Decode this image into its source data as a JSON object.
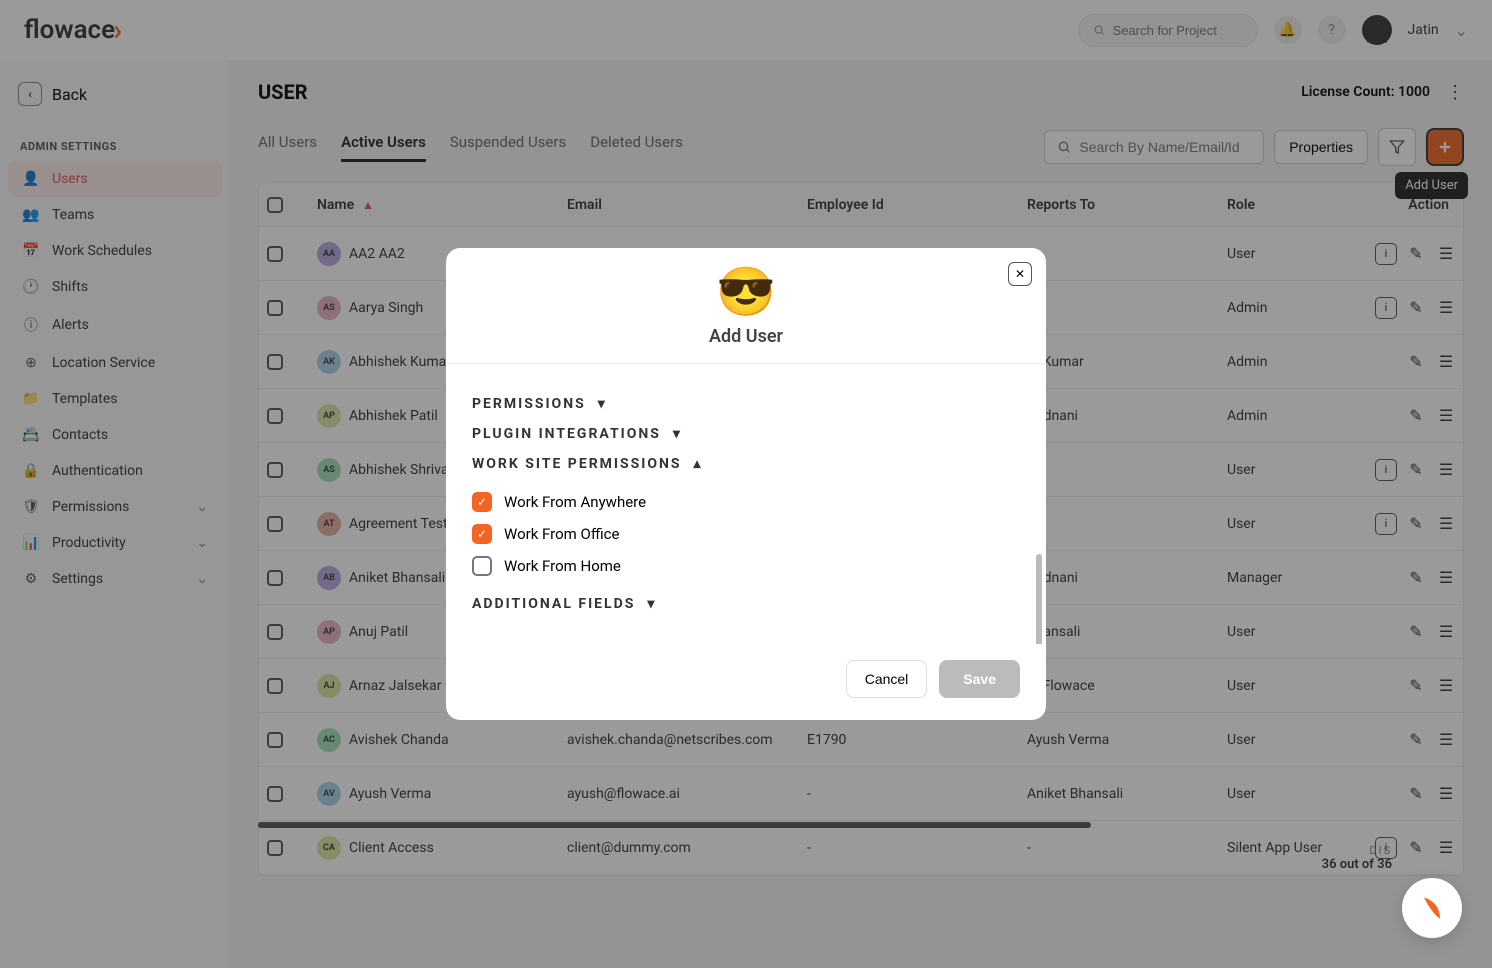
{
  "header": {
    "logo": "flowace",
    "search_placeholder": "Search for Project",
    "user_name": "Jatin"
  },
  "sidebar": {
    "back_label": "Back",
    "heading": "ADMIN SETTINGS",
    "items": [
      {
        "label": "Users",
        "icon": "user",
        "active": true
      },
      {
        "label": "Teams",
        "icon": "team"
      },
      {
        "label": "Work Schedules",
        "icon": "calendar"
      },
      {
        "label": "Shifts",
        "icon": "clock"
      },
      {
        "label": "Alerts",
        "icon": "alert"
      },
      {
        "label": "Location Service",
        "icon": "location"
      },
      {
        "label": "Templates",
        "icon": "folder"
      },
      {
        "label": "Contacts",
        "icon": "contact"
      },
      {
        "label": "Authentication",
        "icon": "lock"
      },
      {
        "label": "Permissions",
        "icon": "shield",
        "has_children": true
      },
      {
        "label": "Productivity",
        "icon": "chart",
        "has_children": true
      },
      {
        "label": "Settings",
        "icon": "gear",
        "has_children": true
      }
    ]
  },
  "page": {
    "title": "USER",
    "license_label": "License Count: 1000",
    "tabs": [
      "All Users",
      "Active Users",
      "Suspended Users",
      "Deleted Users"
    ],
    "active_tab": 1,
    "search_placeholder": "Search By Name/Email/Id",
    "properties_btn": "Properties",
    "add_tooltip": "Add User"
  },
  "table": {
    "columns": [
      "",
      "Name",
      "Email",
      "Employee Id",
      "Reports To",
      "Role",
      "Action"
    ],
    "rows": [
      {
        "initials": "AA",
        "name": "AA2 AA2",
        "email": "",
        "emp": "",
        "reports": "",
        "role": "User",
        "color": "#b6a7e3",
        "has_info": true
      },
      {
        "initials": "AS",
        "name": "Aarya Singh",
        "email": "",
        "emp": "",
        "reports": "",
        "role": "Admin",
        "color": "#e9b3c1",
        "has_info": true
      },
      {
        "initials": "AK",
        "name": "Abhishek Kumar",
        "email": "",
        "emp": "",
        "reports": "nt Kumar",
        "role": "Admin",
        "color": "#a8d3e8"
      },
      {
        "initials": "AP",
        "name": "Abhishek Patil",
        "email": "",
        "emp": "",
        "reports": "Kodnani",
        "role": "Admin",
        "color": "#d8e8a1"
      },
      {
        "initials": "AS",
        "name": "Abhishek Shrivastava",
        "email": "",
        "emp": "",
        "reports": "",
        "role": "User",
        "color": "#a3e0b8",
        "has_info": true
      },
      {
        "initials": "AT",
        "name": "Agreement Testing",
        "email": "",
        "emp": "",
        "reports": "",
        "role": "User",
        "color": "#e8b0a3",
        "has_info": true
      },
      {
        "initials": "AB",
        "name": "Aniket Bhansali",
        "email": "",
        "emp": "",
        "reports": "Kodnani",
        "role": "Manager",
        "color": "#b6a7e3"
      },
      {
        "initials": "AP",
        "name": "Anuj Patil",
        "email": "",
        "emp": "",
        "reports": "Bhansali",
        "role": "User",
        "color": "#e9b3c1"
      },
      {
        "initials": "AJ",
        "name": "Arnaz Jalsekar",
        "email": "",
        "emp": "",
        "reports": "ta Flowace",
        "role": "User",
        "color": "#d8e8a1"
      },
      {
        "initials": "AC",
        "name": "Avishek Chanda",
        "email": "avishek.chanda@netscribes.com",
        "emp": "E1790",
        "reports": "Ayush Verma",
        "role": "User",
        "color": "#a3e0b8"
      },
      {
        "initials": "AV",
        "name": "Ayush Verma",
        "email": "ayush@flowace.ai",
        "emp": "-",
        "reports": "Aniket Bhansali",
        "role": "User",
        "color": "#a8d3e8"
      },
      {
        "initials": "CA",
        "name": "Client Access",
        "email": "client@dummy.com",
        "emp": "-",
        "reports": "-",
        "role": "Silent App User",
        "color": "#d8e8a1",
        "has_info": true
      }
    ]
  },
  "pagination": {
    "line1": "DIS",
    "line2": "36 out of 36"
  },
  "modal": {
    "title": "Add User",
    "sections": {
      "permissions": "PERMISSIONS",
      "plugins": "PLUGIN INTEGRATIONS",
      "worksite": "WORK SITE PERMISSIONS",
      "additional": "ADDITIONAL FIELDS"
    },
    "worksite_options": [
      {
        "label": "Work From Anywhere",
        "checked": true
      },
      {
        "label": "Work From Office",
        "checked": true
      },
      {
        "label": "Work From Home",
        "checked": false
      }
    ],
    "cancel_btn": "Cancel",
    "save_btn": "Save"
  }
}
